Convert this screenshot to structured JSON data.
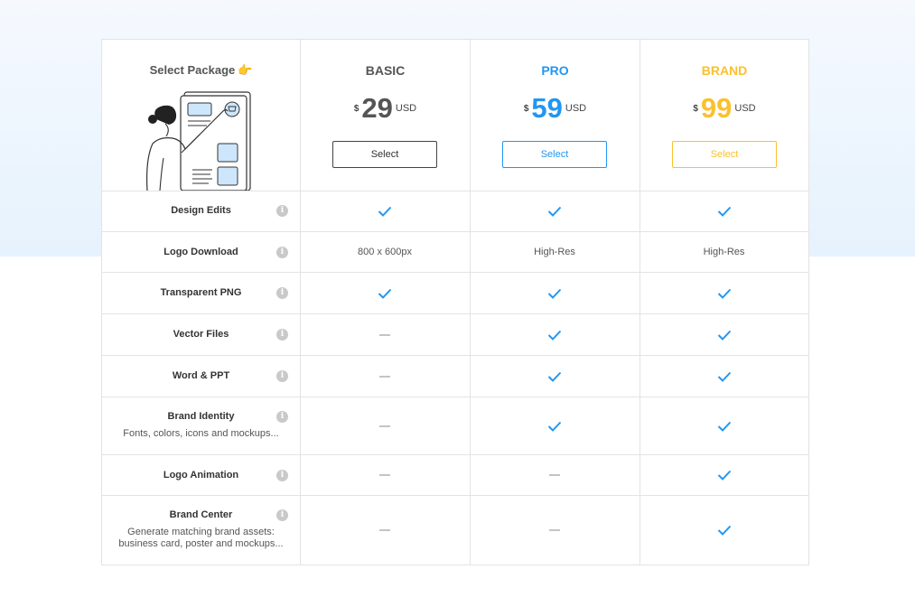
{
  "header": {
    "select_package": "Select Package",
    "hand_emoji": "👉"
  },
  "plans": [
    {
      "name": "BASIC",
      "currency": "$",
      "price": "29",
      "unit": "USD",
      "button": "Select",
      "color": "#555555"
    },
    {
      "name": "PRO",
      "currency": "$",
      "price": "59",
      "unit": "USD",
      "button": "Select",
      "color": "#2196f3"
    },
    {
      "name": "BRAND",
      "currency": "$",
      "price": "99",
      "unit": "USD",
      "button": "Select",
      "color": "#fbc02d"
    }
  ],
  "features": [
    {
      "name": "Design Edits",
      "desc": "",
      "values": [
        "check",
        "check",
        "check"
      ]
    },
    {
      "name": "Logo Download",
      "desc": "",
      "values": [
        "800 x 600px",
        "High-Res",
        "High-Res"
      ]
    },
    {
      "name": "Transparent PNG",
      "desc": "",
      "values": [
        "check",
        "check",
        "check"
      ]
    },
    {
      "name": "Vector Files",
      "desc": "",
      "values": [
        "dash",
        "check",
        "check"
      ]
    },
    {
      "name": "Word & PPT",
      "desc": "",
      "values": [
        "dash",
        "check",
        "check"
      ]
    },
    {
      "name": "Brand Identity",
      "desc": "Fonts, colors, icons and mockups...",
      "values": [
        "dash",
        "check",
        "check"
      ]
    },
    {
      "name": "Logo Animation",
      "desc": "",
      "values": [
        "dash",
        "dash",
        "check"
      ]
    },
    {
      "name": "Brand Center",
      "desc": "Generate matching brand assets:\nbusiness card, poster and mockups...",
      "values": [
        "dash",
        "dash",
        "check"
      ]
    }
  ],
  "colors": {
    "check": "#2196f3",
    "dash": "#c4c4c4",
    "border": "#e3e3e3"
  },
  "icons": {
    "info": "info-icon",
    "check": "check-icon",
    "dash": "dash-icon",
    "hand": "pointing-hand-icon"
  }
}
